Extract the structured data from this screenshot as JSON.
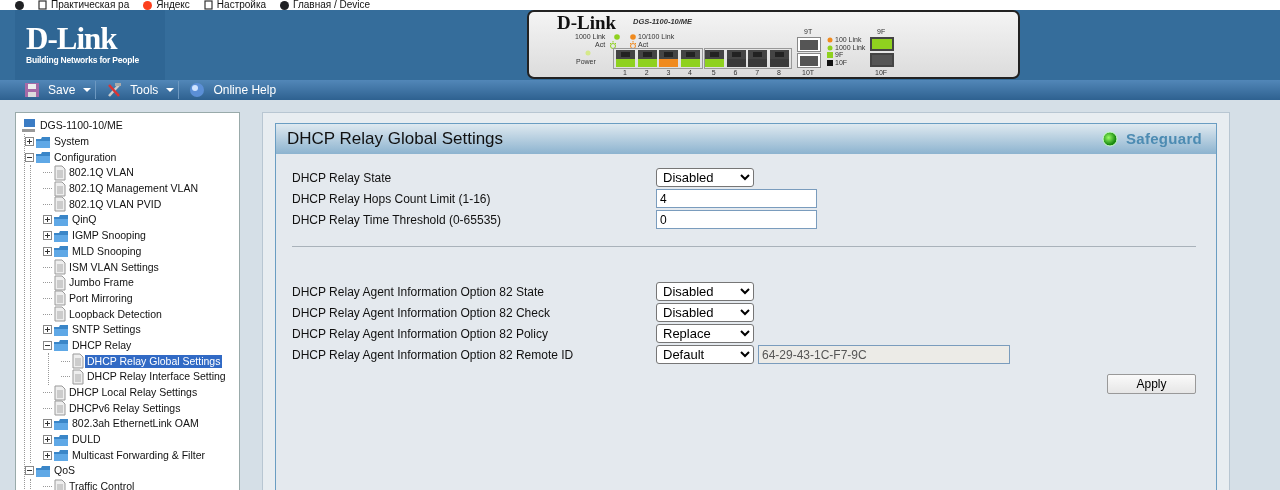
{
  "bookmarks": [
    {
      "kind": "site",
      "color": "#202124"
    },
    {
      "kind": "page",
      "label": "Практическая ра"
    },
    {
      "kind": "site",
      "color": "#fc3f1d",
      "label": "Яндекс"
    },
    {
      "kind": "page",
      "label": "Настройка"
    },
    {
      "kind": "site",
      "color": "#202124",
      "label": "Главная / Device"
    }
  ],
  "header": {
    "logo": {
      "brand": "D-Link",
      "tagline": "Building Networks for People"
    },
    "front_panel": {
      "brand": "D-Link",
      "model": "DGS-1100-10/ME",
      "power": "Power",
      "legend_left": [
        {
          "label": "1000 Link",
          "act": "Act",
          "color": "#8fd11f"
        },
        {
          "label": "10/100 Link",
          "act": "Act",
          "color": "#f08a1e"
        }
      ],
      "ports": [
        {
          "number": "1",
          "color": "#8fd11f"
        },
        {
          "number": "2",
          "color": "#8fd11f"
        },
        {
          "number": "3",
          "color": "#f08a1e"
        },
        {
          "number": "4",
          "color": "#8fd11f"
        },
        {
          "number": "5",
          "color": "#8fd11f"
        },
        {
          "number": "6",
          "color": "#3a3a3a"
        },
        {
          "number": "7",
          "color": "#3a3a3a"
        },
        {
          "number": "8",
          "color": "#3a3a3a"
        }
      ],
      "copper": [
        {
          "label": "9T"
        },
        {
          "label": "10T"
        }
      ],
      "legend_right": [
        {
          "label": "100 Link",
          "kind": "dot",
          "color": "#f08a1e"
        },
        {
          "label": "1000 Link",
          "kind": "dot",
          "color": "#8fd11f"
        },
        {
          "label": "9F",
          "kind": "square",
          "color": "#8fd11f"
        },
        {
          "label": "10F",
          "kind": "square",
          "color": "#111111"
        }
      ],
      "fiber": [
        {
          "label": "9F",
          "color": "#8fd11f"
        },
        {
          "label": "10F",
          "color": "#555555"
        }
      ]
    }
  },
  "toolbar": [
    {
      "label": "Save",
      "kind": "save",
      "dropdown": true
    },
    {
      "label": "Tools",
      "kind": "tools",
      "dropdown": true
    },
    {
      "label": "Online Help",
      "kind": "help",
      "dropdown": false
    }
  ],
  "tree": {
    "label": "DGS-1100-10/ME",
    "kind": "device",
    "selected": false,
    "children": [
      {
        "label": "System",
        "kind": "folder",
        "selected": false,
        "expanded": false
      },
      {
        "label": "Configuration",
        "kind": "folder",
        "selected": false,
        "expanded": true,
        "children": [
          {
            "label": "802.1Q VLAN",
            "kind": "page",
            "selected": false
          },
          {
            "label": "802.1Q Management VLAN",
            "kind": "page",
            "selected": false
          },
          {
            "label": "802.1Q VLAN PVID",
            "kind": "page",
            "selected": false
          },
          {
            "label": "QinQ",
            "kind": "folder",
            "selected": false,
            "expanded": false
          },
          {
            "label": "IGMP Snooping",
            "kind": "folder",
            "selected": false,
            "expanded": false
          },
          {
            "label": "MLD Snooping",
            "kind": "folder",
            "selected": false,
            "expanded": false
          },
          {
            "label": "ISM VLAN Settings",
            "kind": "page",
            "selected": false
          },
          {
            "label": "Jumbo Frame",
            "kind": "page",
            "selected": false
          },
          {
            "label": "Port Mirroring",
            "kind": "page",
            "selected": false
          },
          {
            "label": "Loopback Detection",
            "kind": "page",
            "selected": false
          },
          {
            "label": "SNTP Settings",
            "kind": "folder",
            "selected": false,
            "expanded": false
          },
          {
            "label": "DHCP Relay",
            "kind": "folder",
            "selected": false,
            "expanded": true,
            "children": [
              {
                "label": "DHCP Relay Global Settings",
                "kind": "page",
                "selected": true
              },
              {
                "label": "DHCP Relay Interface Setting",
                "kind": "page",
                "selected": false
              }
            ]
          },
          {
            "label": "DHCP Local Relay Settings",
            "kind": "page",
            "selected": false
          },
          {
            "label": "DHCPv6 Relay Settings",
            "kind": "page",
            "selected": false
          },
          {
            "label": "802.3ah EthernetLink OAM",
            "kind": "folder",
            "selected": false,
            "expanded": false
          },
          {
            "label": "DULD",
            "kind": "folder",
            "selected": false,
            "expanded": false
          },
          {
            "label": "Multicast Forwarding & Filter",
            "kind": "folder",
            "selected": false,
            "expanded": false
          }
        ]
      },
      {
        "label": "QoS",
        "kind": "folder",
        "selected": false,
        "expanded": true,
        "children": [
          {
            "label": "Traffic Control",
            "kind": "page",
            "selected": false
          }
        ]
      }
    ]
  },
  "panel": {
    "title": "DHCP Relay Global Settings",
    "safeguard": "Safeguard",
    "apply": "Apply",
    "groups": [
      [
        {
          "kind": "select",
          "label": "DHCP Relay State",
          "value": "Disabled"
        },
        {
          "kind": "input",
          "label": "DHCP Relay Hops Count Limit (1-16)",
          "value": "4"
        },
        {
          "kind": "input",
          "label": "DHCP Relay Time Threshold (0-65535)",
          "value": "0"
        }
      ],
      [
        {
          "kind": "select",
          "label": "DHCP Relay Agent Information Option 82 State",
          "value": "Disabled"
        },
        {
          "kind": "select",
          "label": "DHCP Relay Agent Information Option 82 Check",
          "value": "Disabled"
        },
        {
          "kind": "select",
          "label": "DHCP Relay Agent Information Option 82 Policy",
          "value": "Replace"
        },
        {
          "kind": "select_input",
          "label": "DHCP Relay Agent Information Option 82 Remote ID",
          "value": "Default",
          "extra_value": "64-29-43-1C-F7-9C",
          "extra_disabled": true
        }
      ]
    ]
  }
}
